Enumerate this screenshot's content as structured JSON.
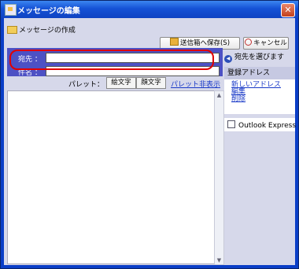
{
  "window": {
    "title": "メッセージの編集",
    "close_glyph": "✕"
  },
  "header": {
    "label": "メッセージの作成"
  },
  "toolbar": {
    "save_label": "送信箱へ保存(S)",
    "cancel_label": "キャンセル"
  },
  "form": {
    "to_label": "宛先 ：",
    "to_value": "",
    "subject_label": "件名 ：",
    "subject_value": ""
  },
  "palette": {
    "label": "パレット：",
    "buttons": [
      "絵文字",
      "顔文字"
    ],
    "hide_link": "パレット非表示"
  },
  "sidebar": {
    "choose_recipient": "宛先を選びます",
    "registered": {
      "title": "登録アドレス",
      "links": [
        "新しいアドレス",
        "編集",
        "削除"
      ]
    },
    "outlook": {
      "label": "Outlook Express"
    }
  },
  "colors": {
    "title_bar": "#0f43c2",
    "form_band": "#4d51c4",
    "highlight": "#e00000",
    "link": "#1a3ac8"
  }
}
